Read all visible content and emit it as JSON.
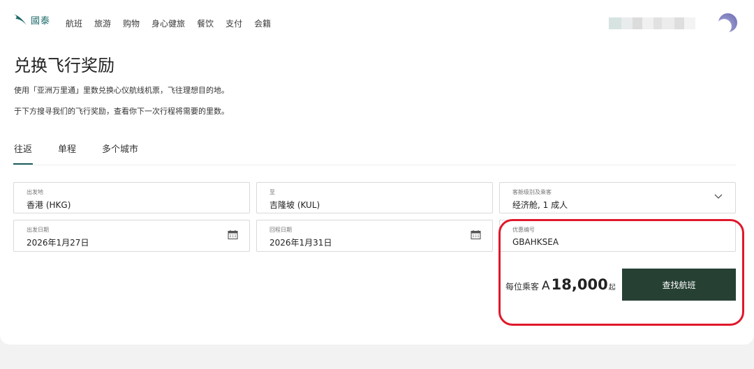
{
  "header": {
    "logo_text": "國泰",
    "nav": [
      "航班",
      "旅游",
      "购物",
      "身心健旅",
      "餐饮",
      "支付",
      "会籍"
    ]
  },
  "page": {
    "title": "兑换飞行奖励",
    "desc1": "使用「亚洲万里通」里数兑换心仪航线机票，飞往理想目的地。",
    "desc2": "于下方搜寻我们的飞行奖励，查看你下一次行程将需要的里数。"
  },
  "tabs": [
    "往返",
    "单程",
    "多个城市"
  ],
  "form": {
    "origin": {
      "label": "出发地",
      "value": "香港 (HKG)"
    },
    "destination": {
      "label": "至",
      "value": "吉隆坡 (KUL)"
    },
    "cabin": {
      "label": "客舱级别及乘客",
      "value": "经济舱, 1 成人"
    },
    "depart_date": {
      "label": "出发日期",
      "value": "2026年1月27日"
    },
    "return_date": {
      "label": "回程日期",
      "value": "2026年1月31日"
    },
    "promo": {
      "label": "优惠编号",
      "value": "GBAHKSEA"
    }
  },
  "price": {
    "label": "每位乘客",
    "symbol": "A",
    "amount": "18,000",
    "suffix": "起"
  },
  "search_button": "查找航班",
  "colors": {
    "brand_teal": "#1d6a6a",
    "button": "#264134",
    "highlight": "#e0182b"
  },
  "icons": {
    "logo": "cathay-wing-icon",
    "dropdown": "chevron-down-icon",
    "calendar": "calendar-icon"
  }
}
